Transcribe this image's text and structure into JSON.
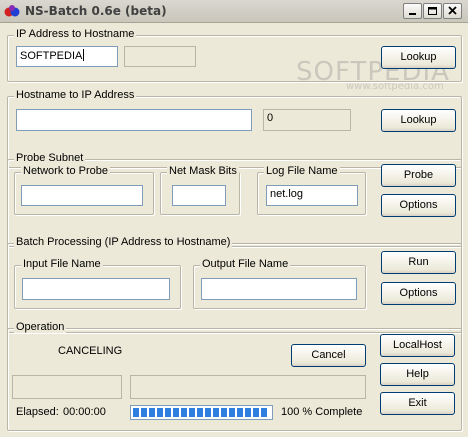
{
  "window": {
    "title": "NS-Batch 0.6e (beta)"
  },
  "ip_to_host": {
    "legend": "IP Address to Hostname",
    "ip_value": "SOFTPEDIA",
    "result_value": "",
    "lookup_label": "Lookup"
  },
  "host_to_ip": {
    "legend": "Hostname to IP Address",
    "host_value": "",
    "result_value": "0",
    "lookup_label": "Lookup"
  },
  "probe": {
    "legend": "Probe Subnet",
    "network_legend": "Network to Probe",
    "network_value": "",
    "mask_legend": "Net Mask Bits",
    "mask_value": "",
    "log_legend": "Log File Name",
    "log_value": "net.log",
    "probe_label": "Probe",
    "options_label": "Options"
  },
  "batch": {
    "legend": "Batch Processing  (IP Address to Hostname)",
    "input_legend": "Input File Name",
    "input_value": "",
    "output_legend": "Output File Name",
    "output_value": "",
    "run_label": "Run",
    "options_label": "Options"
  },
  "operation": {
    "legend": "Operation",
    "status": "CANCELING",
    "cancel_label": "Cancel",
    "field_left": "",
    "field_right": "",
    "elapsed_label": "Elapsed:",
    "elapsed_value": "00:00:00",
    "progress_percent": 100,
    "complete_text": "100 % Complete"
  },
  "side": {
    "localhost_label": "LocalHost",
    "help_label": "Help",
    "exit_label": "Exit"
  },
  "watermark": {
    "big": "SOFTPEDIA",
    "small": "www.softpedia.com"
  },
  "colors": {
    "progress_fill": "#2f7fe0",
    "window_bg": "#ece9d8"
  }
}
